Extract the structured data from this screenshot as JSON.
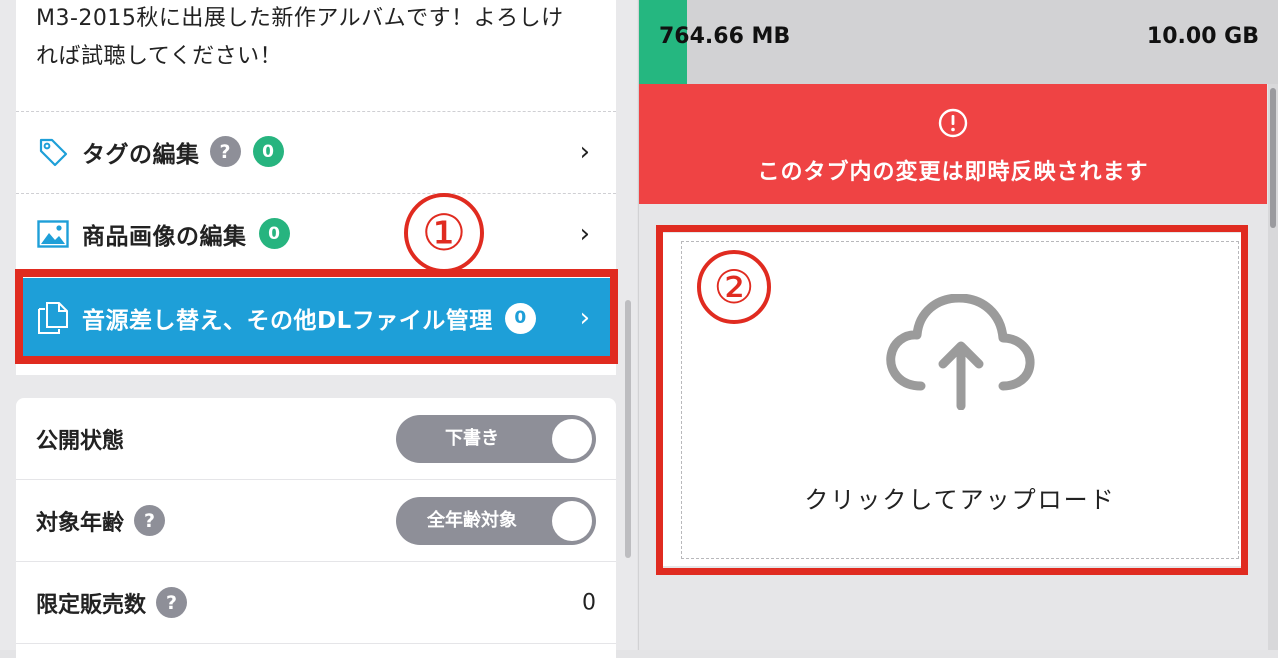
{
  "description": {
    "line1": "M3-2015秋に出展した新作アルバムです！よろしけ",
    "line2": "れば試聴してください！"
  },
  "menu": [
    {
      "label": "タグの編集",
      "help": "?",
      "count": "0",
      "icon": "tag-icon"
    },
    {
      "label": "商品画像の編集",
      "count": "0",
      "icon": "image-icon"
    },
    {
      "label": "音源差し替え、その他DLファイル管理",
      "count": "0",
      "icon": "files-icon",
      "active": true
    }
  ],
  "annotations": {
    "circle1": "①",
    "circle2": "②"
  },
  "settings": {
    "publish": {
      "label": "公開状態",
      "toggle_text": "下書き"
    },
    "age": {
      "label": "対象年齢",
      "help": "?",
      "toggle_text": "全年齢対象"
    },
    "limit": {
      "label": "限定販売数",
      "help": "?",
      "value": "0"
    }
  },
  "storage": {
    "used": "764.66 MB",
    "total": "10.00 GB",
    "fill_fraction": 0.075
  },
  "alert": {
    "text": "このタブ内の変更は即時反映されます",
    "icon": "exclamation-circle-icon"
  },
  "upload": {
    "label": "クリックしてアップロード",
    "icon": "cloud-upload-icon"
  },
  "colors": {
    "active": "#1e9fd8",
    "badge": "#27b47f",
    "alert": "#ef4344",
    "highlight": "#e02b20",
    "storage_fill": "#25b780"
  }
}
